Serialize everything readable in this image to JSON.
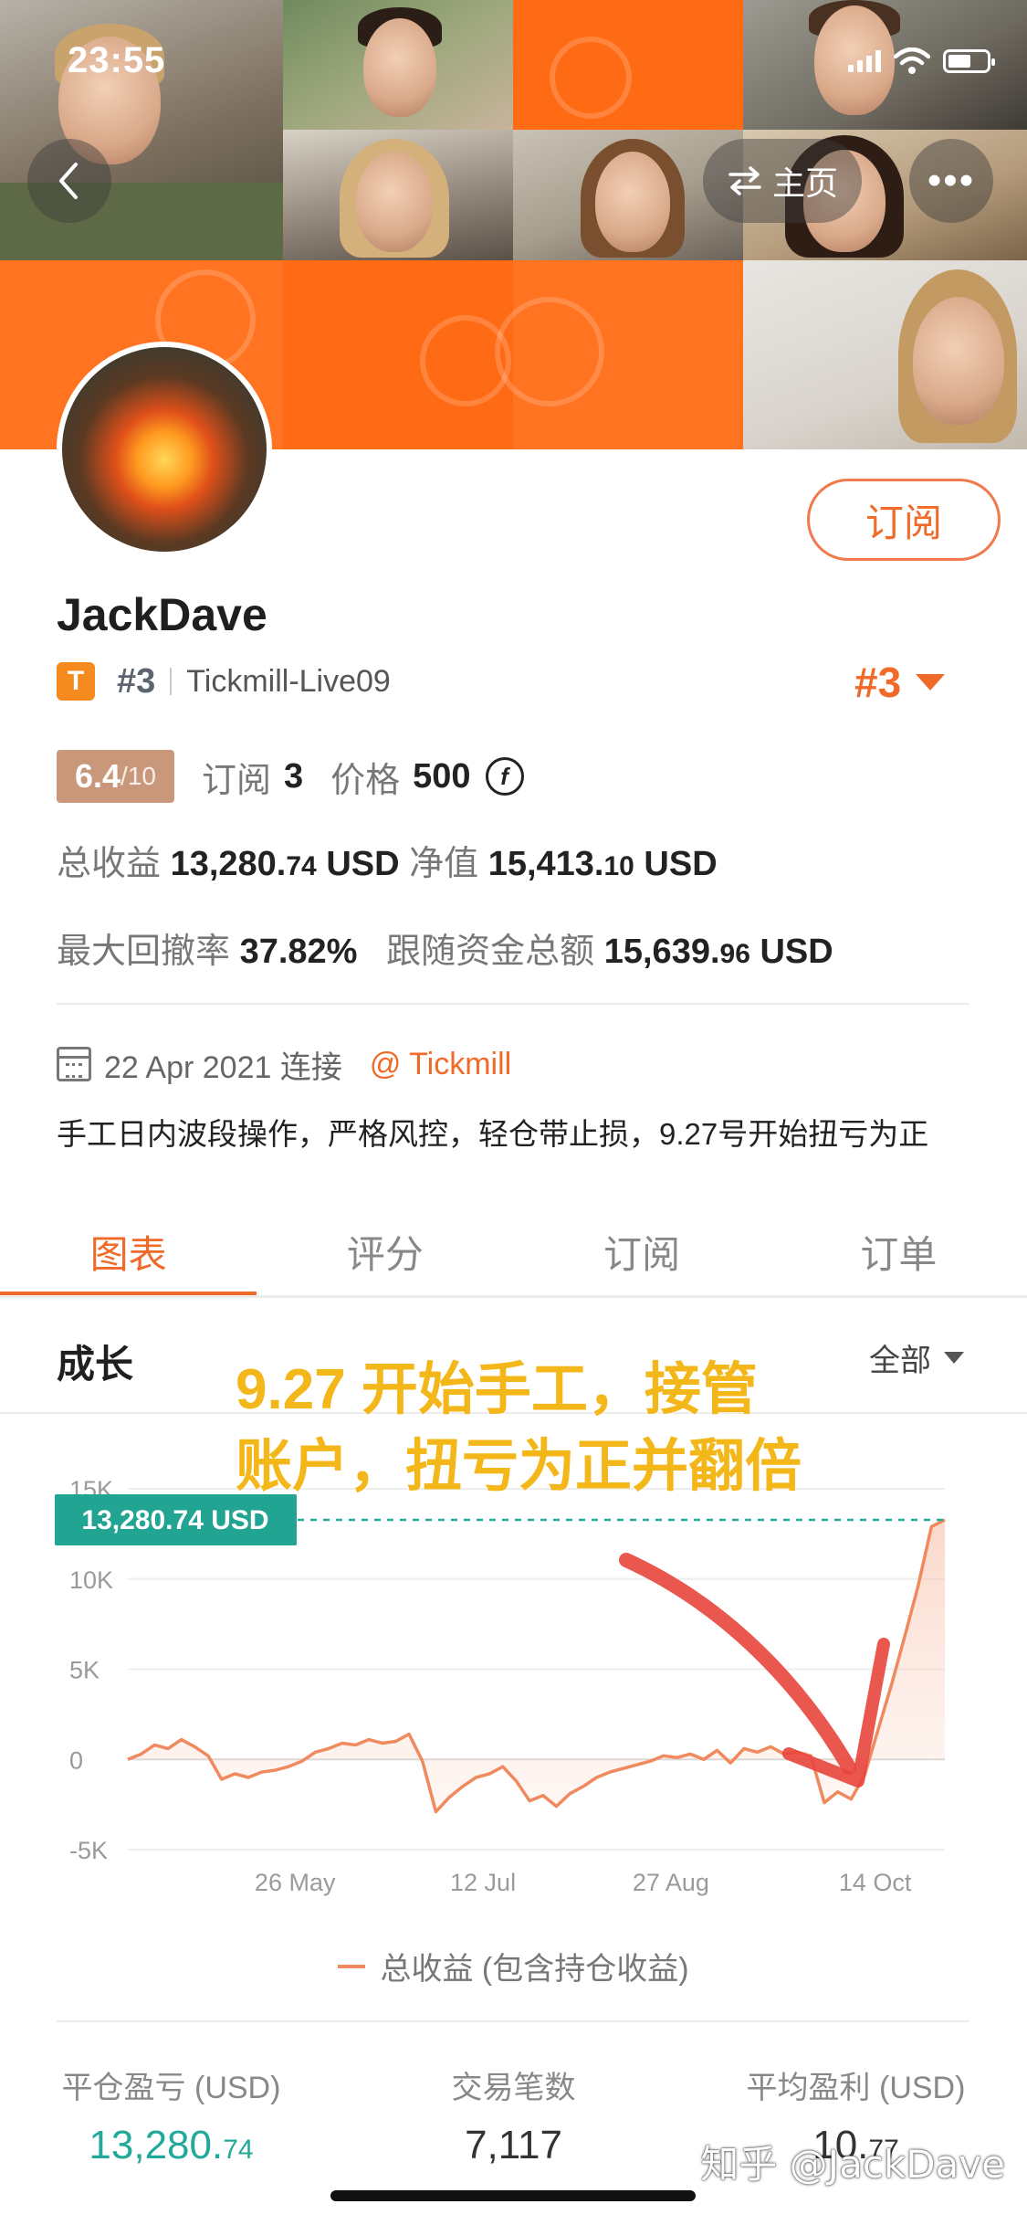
{
  "status_bar": {
    "time": "23:55"
  },
  "header": {
    "home_label": "主页",
    "more_label": "•••"
  },
  "profile": {
    "subscribe_label": "订阅",
    "username": "JackDave",
    "badge_letter": "T",
    "rank_small": "#3",
    "account": "Tickmill-Live09",
    "rank_big": "#3",
    "score": "6.4",
    "score_denom": "/10",
    "subscribe_count_label": "订阅",
    "subscribe_count": "3",
    "price_label": "价格",
    "price": "500",
    "coin_symbol": "f",
    "total_profit_label": "总收益",
    "total_profit_main": "13,280.",
    "total_profit_dec": "74",
    "total_profit_unit": "USD",
    "net_value_label": "净值",
    "net_value_main": "15,413.",
    "net_value_dec": "10",
    "net_value_unit": "USD",
    "max_drawdown_label": "最大回撤率",
    "max_drawdown": "37.82%",
    "follow_funds_label": "跟随资金总额",
    "follow_funds_main": "15,639.",
    "follow_funds_dec": "96",
    "follow_funds_unit": "USD",
    "connect_date": "22 Apr 2021 连接",
    "broker": "@ Tickmill",
    "description": "手工日内波段操作，严格风控，轻仓带止损，9.27号开始扭亏为正"
  },
  "tabs": [
    {
      "label": "图表"
    },
    {
      "label": "评分"
    },
    {
      "label": "订阅"
    },
    {
      "label": "订单"
    }
  ],
  "section": {
    "title": "成长",
    "filter": "全部"
  },
  "annotation": {
    "line1": "9.27 开始手工，接管",
    "line2": "账户，扭亏为正并翻倍"
  },
  "chart_data": {
    "type": "area",
    "current_value_label": "13,280.74 USD",
    "y_ticks": [
      "15K",
      "10K",
      "5K",
      "0",
      "-5K"
    ],
    "y_tick_values": [
      15000,
      10000,
      5000,
      0,
      -5000
    ],
    "x_ticks": [
      "26 May",
      "12 Jul",
      "27 Aug",
      "14 Oct"
    ],
    "ylim": [
      -5000,
      15000
    ],
    "series": [
      {
        "name": "总收益 (包含持仓收益)",
        "color": "#f08a5e",
        "values": [
          0,
          300,
          800,
          600,
          1100,
          700,
          200,
          -1100,
          -800,
          -1000,
          -700,
          -600,
          -400,
          -100,
          400,
          600,
          900,
          800,
          1100,
          900,
          1000,
          1400,
          -100,
          -2900,
          -2100,
          -1500,
          -1000,
          -800,
          -400,
          -1200,
          -2300,
          -2000,
          -2600,
          -1900,
          -1500,
          -1000,
          -700,
          -500,
          -300,
          -100,
          200,
          100,
          300,
          0,
          500,
          -200,
          600,
          400,
          700,
          300,
          400,
          200,
          -2400,
          -1800,
          -2200,
          -900,
          1600,
          4100,
          6800,
          9600,
          12900,
          13280.74
        ]
      }
    ]
  },
  "legend": {
    "label": "总收益 (包含持仓收益)"
  },
  "bottom_stats": [
    {
      "label": "平仓盈亏 (USD)",
      "value_main": "13,280.",
      "value_dec": "74"
    },
    {
      "label": "交易笔数",
      "value_main": "7,117",
      "value_dec": ""
    },
    {
      "label": "平均盈利 (USD)",
      "value_main": "10.",
      "value_dec": "77"
    }
  ],
  "watermark": "知乎 @JackDave"
}
